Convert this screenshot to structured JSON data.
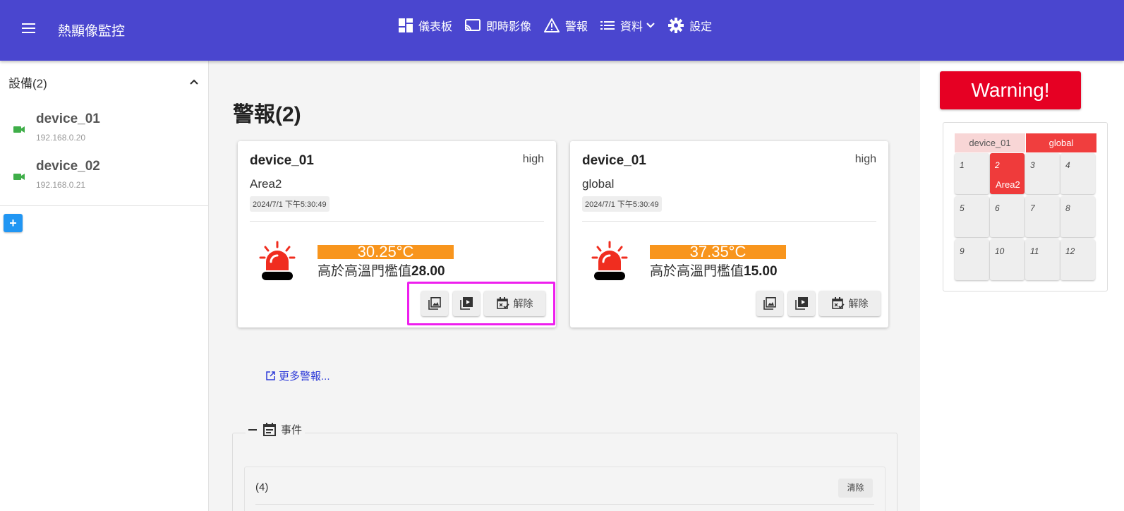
{
  "app": {
    "title": "熱顯像監控"
  },
  "nav": {
    "dashboard": "儀表板",
    "live": "即時影像",
    "alerts": "警報",
    "data": "資料",
    "settings": "設定"
  },
  "sidebar": {
    "header": "設備(2)",
    "devices": [
      {
        "name": "device_01",
        "ip": "192.168.0.20"
      },
      {
        "name": "device_02",
        "ip": "192.168.0.21"
      }
    ],
    "add_label": "+"
  },
  "main": {
    "title": "警報(2)",
    "alerts": [
      {
        "device": "device_01",
        "level": "high",
        "area": "Area2",
        "time": "2024/7/1 下午5:30:49",
        "temperature": "30.25°C",
        "threshold_text": "高於高溫門檻值",
        "threshold_value": "28.00",
        "dismiss_label": "解除"
      },
      {
        "device": "device_01",
        "level": "high",
        "area": "global",
        "time": "2024/7/1 下午5:30:49",
        "temperature": "37.35°C",
        "threshold_text": "高於高溫門檻值",
        "threshold_value": "15.00",
        "dismiss_label": "解除"
      }
    ],
    "more_link": "更多警報...",
    "events": {
      "legend": "事件",
      "count": "(4)",
      "clear_label": "清除"
    }
  },
  "right": {
    "warning": "Warning!",
    "tabs": [
      "device_01",
      "global"
    ],
    "cells": [
      {
        "num": "1",
        "label": ""
      },
      {
        "num": "2",
        "label": "Area2"
      },
      {
        "num": "3",
        "label": ""
      },
      {
        "num": "4",
        "label": ""
      },
      {
        "num": "5",
        "label": ""
      },
      {
        "num": "6",
        "label": ""
      },
      {
        "num": "7",
        "label": ""
      },
      {
        "num": "8",
        "label": ""
      },
      {
        "num": "9",
        "label": ""
      },
      {
        "num": "10",
        "label": ""
      },
      {
        "num": "11",
        "label": ""
      },
      {
        "num": "12",
        "label": ""
      }
    ]
  },
  "colors": {
    "topbar": "#4a46cf",
    "warning": "#e60023",
    "temp_badge": "#f8951d",
    "active_cell": "#ef3b3b",
    "link": "#2d3ad8"
  }
}
